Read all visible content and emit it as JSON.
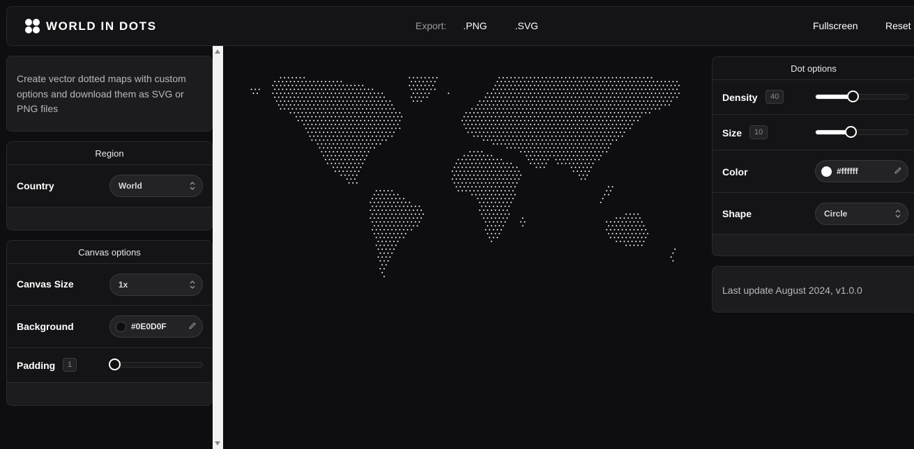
{
  "app": {
    "title": "WORLD IN DOTS",
    "logo_icon": "four-dots-logo-icon"
  },
  "header": {
    "export_label": "Export:",
    "export_png": ".PNG",
    "export_svg": ".SVG",
    "fullscreen": "Fullscreen",
    "reset": "Reset"
  },
  "intro": {
    "text": "Create vector dotted maps with custom options and download them as SVG or PNG files"
  },
  "region": {
    "title": "Region",
    "country_label": "Country",
    "country_value": "World"
  },
  "canvas": {
    "title": "Canvas options",
    "size_label": "Canvas Size",
    "size_value": "1x",
    "background_label": "Background",
    "background_value": "#0E0D0F",
    "background_color": "#0e0d0f",
    "padding_label": "Padding",
    "padding_value": "1",
    "padding_level": 0
  },
  "dots": {
    "title": "Dot options",
    "density_label": "Density",
    "density_value": "40",
    "density_level": 0.4,
    "size_label": "Size",
    "size_value": "10",
    "size_level": 0.38,
    "color_label": "Color",
    "color_value": "#ffffff",
    "dot_color": "#ffffff",
    "shape_label": "Shape",
    "shape_value": "Circle"
  },
  "footer": {
    "last_update": "Last update August 2024, v1.0.0"
  }
}
